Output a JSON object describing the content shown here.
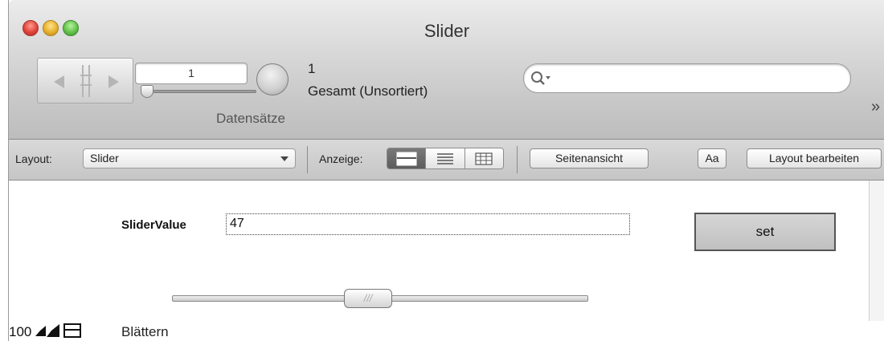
{
  "window": {
    "title": "Slider"
  },
  "toolbar": {
    "record_number": "1",
    "record_total": "1",
    "record_state": "Gesamt (Unsortiert)",
    "records_caption": "Datensätze",
    "search_placeholder": "",
    "overflow": "»"
  },
  "layout_bar": {
    "layout_label": "Layout:",
    "layout_value": "Slider",
    "view_label": "Anzeige:",
    "view_modes": [
      "form-view-icon",
      "list-view-icon",
      "table-view-icon"
    ],
    "active_view": "form-view-icon",
    "preview_button": "Seitenansicht",
    "format_button": "Aa",
    "edit_layout_button": "Layout bearbeiten"
  },
  "content": {
    "field_label": "SliderValue",
    "field_value": "47",
    "set_button": "set",
    "slider_value_fraction": 0.47,
    "slider_grip": "///"
  },
  "status_bar": {
    "zoom": "100",
    "mode": "Blättern"
  }
}
